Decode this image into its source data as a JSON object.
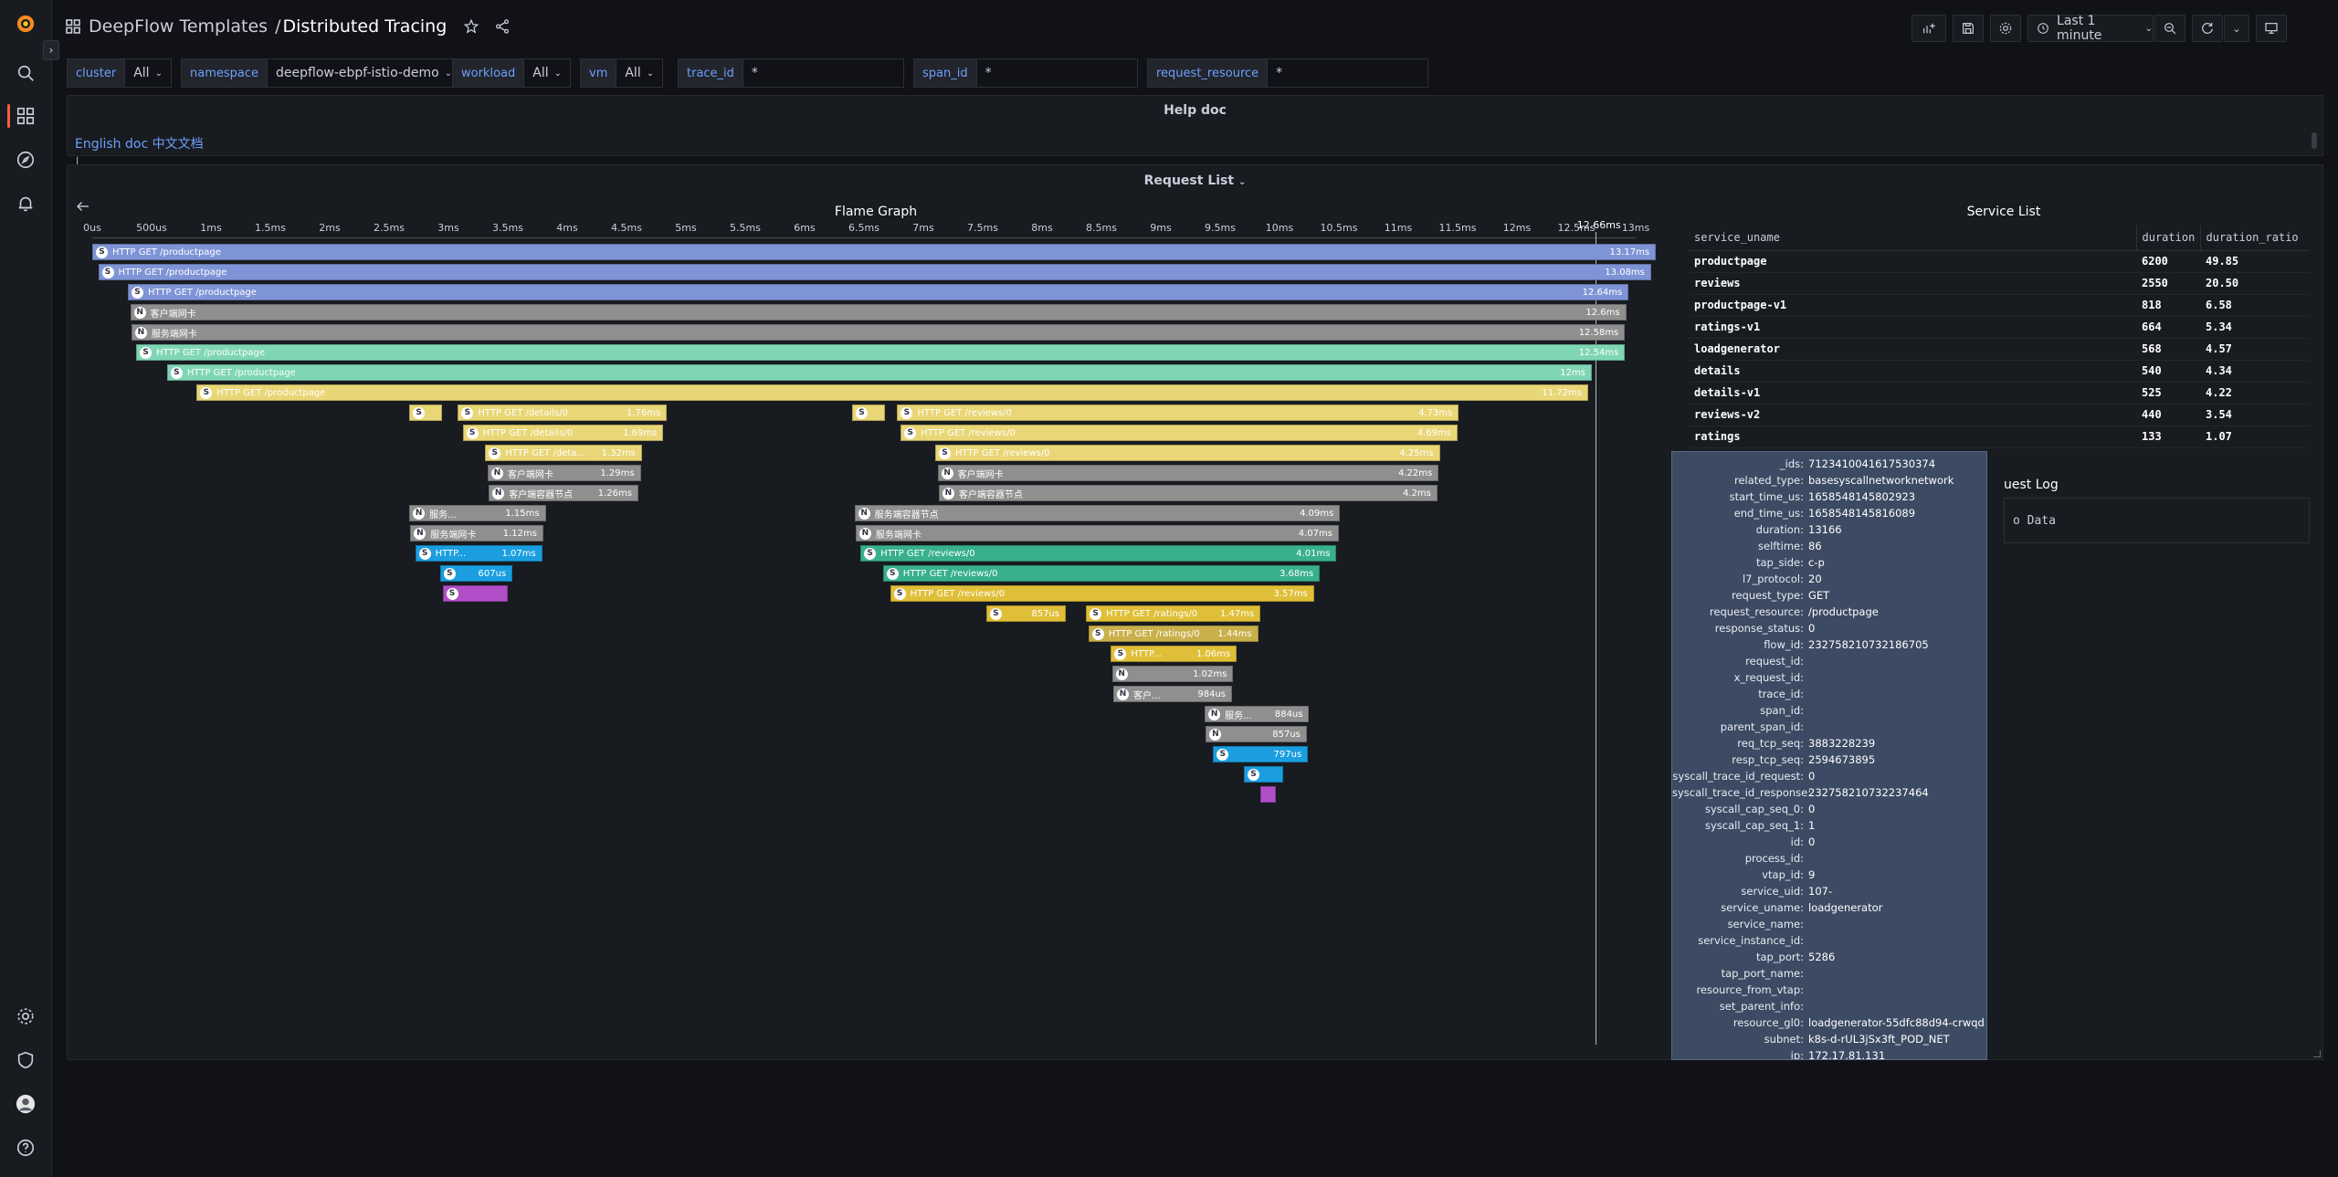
{
  "breadcrumb": {
    "folder": "DeepFlow Templates",
    "separator": "/",
    "page": "Distributed Tracing"
  },
  "toolbar": {
    "time_range": "Last 1 minute"
  },
  "variables": [
    {
      "label": "cluster",
      "value": "All",
      "dropdown": true
    },
    {
      "label": "namespace",
      "value": "deepflow-ebpf-istio-demo",
      "dropdown": true
    },
    {
      "label": "workload",
      "value": "All",
      "dropdown": true
    },
    {
      "label": "vm",
      "value": "All",
      "dropdown": true
    },
    {
      "label": "trace_id",
      "value": "*",
      "dropdown": false
    },
    {
      "label": "span_id",
      "value": "*",
      "dropdown": false
    },
    {
      "label": "request_resource",
      "value": "*",
      "dropdown": false
    }
  ],
  "help": {
    "title": "Help doc",
    "link_en": "English doc",
    "separator": "|",
    "link_zh": "中文文档"
  },
  "request_list": {
    "title": "Request List"
  },
  "flame_graph": {
    "title": "Flame Graph",
    "ticks": [
      "0us",
      "500us",
      "1ms",
      "1.5ms",
      "2ms",
      "2.5ms",
      "3ms",
      "3.5ms",
      "4ms",
      "4.5ms",
      "5ms",
      "5.5ms",
      "6ms",
      "6.5ms",
      "7ms",
      "7.5ms",
      "8ms",
      "8.5ms",
      "9ms",
      "9.5ms",
      "10ms",
      "10.5ms",
      "11ms",
      "11.5ms",
      "12ms",
      "12.5ms",
      "13ms"
    ],
    "cursor_label": "12.66ms",
    "cursor_value_ms": 12.66,
    "colors": {
      "blue": "#7f94d6",
      "green": "#7fd6b5",
      "yellow": "#e9d676",
      "gray": "#8f8f8f",
      "teal": "#38b08c",
      "cyan": "#1a9ee0",
      "purple": "#b14ec8",
      "gold": "#e0bf38",
      "mustard": "#c9b04a"
    },
    "bars": [
      {
        "icon": "S",
        "label": "HTTP GET /productpage",
        "dur": "13.17ms",
        "start": 0.0,
        "end": 13.17,
        "color": "blue"
      },
      {
        "icon": "S",
        "label": "HTTP GET /productpage",
        "dur": "13.08ms",
        "start": 0.05,
        "end": 13.13,
        "color": "blue"
      },
      {
        "icon": "S",
        "label": "HTTP GET /productpage",
        "dur": "12.64ms",
        "start": 0.3,
        "end": 12.94,
        "color": "blue"
      },
      {
        "icon": "N",
        "label": "客户端网卡",
        "dur": "12.6ms",
        "start": 0.32,
        "end": 12.92,
        "color": "gray"
      },
      {
        "icon": "N",
        "label": "服务端网卡",
        "dur": "12.58ms",
        "start": 0.33,
        "end": 12.91,
        "color": "gray"
      },
      {
        "icon": "S",
        "label": "HTTP GET /productpage",
        "dur": "12.54ms",
        "start": 0.37,
        "end": 12.91,
        "color": "green"
      },
      {
        "icon": "S",
        "label": "HTTP GET /productpage",
        "dur": "12ms",
        "start": 0.63,
        "end": 12.63,
        "color": "green"
      },
      {
        "icon": "S",
        "label": "HTTP GET /productpage",
        "dur": "11.72ms",
        "start": 0.88,
        "end": 12.6,
        "color": "yellow"
      },
      {
        "icon": "S",
        "label": "",
        "dur": "",
        "start": 2.67,
        "end": 2.95,
        "color": "yellow"
      },
      {
        "icon": "S",
        "label": "HTTP GET /details/0",
        "dur": "1.76ms",
        "start": 3.08,
        "end": 4.84,
        "color": "yellow"
      },
      {
        "icon": "S",
        "label": "",
        "dur": "",
        "start": 6.4,
        "end": 6.68,
        "color": "yellow"
      },
      {
        "icon": "S",
        "label": "HTTP GET /reviews/0",
        "dur": "4.73ms",
        "start": 6.78,
        "end": 11.51,
        "color": "yellow"
      },
      {
        "icon": "S",
        "label": "HTTP GET /details/0",
        "dur": "1.69ms",
        "start": 3.12,
        "end": 4.81,
        "color": "yellow"
      },
      {
        "icon": "S",
        "label": "HTTP GET /reviews/0",
        "dur": "4.69ms",
        "start": 6.81,
        "end": 11.5,
        "color": "yellow"
      },
      {
        "icon": "S",
        "label": "HTTP GET /deta...",
        "dur": "1.32ms",
        "start": 3.31,
        "end": 4.63,
        "color": "yellow"
      },
      {
        "icon": "S",
        "label": "HTTP GET /reviews/0",
        "dur": "4.25ms",
        "start": 7.1,
        "end": 11.35,
        "color": "yellow"
      },
      {
        "icon": "N",
        "label": "客户端网卡",
        "dur": "1.29ms",
        "start": 3.33,
        "end": 4.62,
        "color": "gray"
      },
      {
        "icon": "N",
        "label": "客户端网卡",
        "dur": "4.22ms",
        "start": 7.12,
        "end": 11.34,
        "color": "gray"
      },
      {
        "icon": "N",
        "label": "客户端容器节点",
        "dur": "1.26ms",
        "start": 3.34,
        "end": 4.6,
        "color": "gray"
      },
      {
        "icon": "N",
        "label": "客户端容器节点",
        "dur": "4.2ms",
        "start": 7.13,
        "end": 11.33,
        "color": "gray"
      },
      {
        "icon": "N",
        "label": "服务...",
        "dur": "1.15ms",
        "start": 2.67,
        "end": 3.82,
        "color": "gray"
      },
      {
        "icon": "N",
        "label": "服务端容器节点",
        "dur": "4.09ms",
        "start": 6.42,
        "end": 10.51,
        "color": "gray"
      },
      {
        "icon": "N",
        "label": "服务端网卡",
        "dur": "1.12ms",
        "start": 2.68,
        "end": 3.8,
        "color": "gray"
      },
      {
        "icon": "N",
        "label": "服务端网卡",
        "dur": "4.07ms",
        "start": 6.43,
        "end": 10.5,
        "color": "gray"
      },
      {
        "icon": "S",
        "label": "HTTP...",
        "dur": "1.07ms",
        "start": 2.72,
        "end": 3.79,
        "color": "cyan"
      },
      {
        "icon": "S",
        "label": "HTTP GET /reviews/0",
        "dur": "4.01ms",
        "start": 6.47,
        "end": 10.48,
        "color": "teal"
      },
      {
        "icon": "S",
        "label": "",
        "dur": "607us",
        "start": 2.93,
        "end": 3.54,
        "color": "cyan"
      },
      {
        "icon": "S",
        "label": "HTTP GET /reviews/0",
        "dur": "3.68ms",
        "start": 6.66,
        "end": 10.34,
        "color": "teal"
      },
      {
        "icon": "S",
        "label": "",
        "dur": "",
        "start": 2.95,
        "end": 3.5,
        "color": "purple"
      },
      {
        "icon": "S",
        "label": "HTTP GET /reviews/0",
        "dur": "3.57ms",
        "start": 6.72,
        "end": 10.29,
        "color": "gold"
      },
      {
        "icon": "S",
        "label": "",
        "dur": "857us",
        "start": 7.53,
        "end": 8.2,
        "color": "gold"
      },
      {
        "icon": "S",
        "label": "HTTP GET /ratings/0",
        "dur": "1.47ms",
        "start": 8.37,
        "end": 9.84,
        "color": "gold"
      },
      {
        "icon": "S",
        "label": "HTTP GET /ratings/0",
        "dur": "1.44ms",
        "start": 8.39,
        "end": 9.82,
        "color": "mustard"
      },
      {
        "icon": "S",
        "label": "HTTP...",
        "dur": "1.06ms",
        "start": 8.58,
        "end": 9.64,
        "color": "gold"
      },
      {
        "icon": "N",
        "label": "",
        "dur": "1.02ms",
        "start": 8.59,
        "end": 9.61,
        "color": "gray"
      },
      {
        "icon": "N",
        "label": "客户...",
        "dur": "984us",
        "start": 8.6,
        "end": 9.6,
        "color": "gray"
      },
      {
        "icon": "N",
        "label": "服务...",
        "dur": "884us",
        "start": 9.37,
        "end": 10.25,
        "color": "gray"
      },
      {
        "icon": "N",
        "label": "",
        "dur": "857us",
        "start": 9.38,
        "end": 10.23,
        "color": "gray"
      },
      {
        "icon": "S",
        "label": "",
        "dur": "797us",
        "start": 9.44,
        "end": 10.24,
        "color": "cyan"
      },
      {
        "icon": "S",
        "label": "",
        "dur": "",
        "start": 9.7,
        "end": 10.03,
        "color": "cyan"
      },
      {
        "icon": "",
        "label": "",
        "dur": "",
        "start": 9.84,
        "end": 9.97,
        "color": "purple"
      }
    ],
    "rows": [
      0,
      1,
      2,
      3,
      4,
      5,
      6,
      7,
      8,
      8,
      8,
      8,
      9,
      9,
      10,
      10,
      11,
      11,
      12,
      12,
      13,
      13,
      14,
      14,
      15,
      15,
      16,
      16,
      17,
      17,
      18,
      18,
      19,
      20,
      21,
      22,
      23,
      24,
      25,
      26,
      27
    ]
  },
  "service_list": {
    "title": "Service List",
    "columns": [
      "service_uname",
      "duration",
      "duration_ratio"
    ],
    "rows": [
      [
        "productpage",
        "6200",
        "49.85"
      ],
      [
        "reviews",
        "2550",
        "20.50"
      ],
      [
        "productpage-v1",
        "818",
        "6.58"
      ],
      [
        "ratings-v1",
        "664",
        "5.34"
      ],
      [
        "loadgenerator",
        "568",
        "4.57"
      ],
      [
        "details",
        "540",
        "4.34"
      ],
      [
        "details-v1",
        "525",
        "4.22"
      ],
      [
        "reviews-v2",
        "440",
        "3.54"
      ],
      [
        "ratings",
        "133",
        "1.07"
      ]
    ]
  },
  "request_log": {
    "title_visible": "uest Log",
    "nodata_visible": "o Data"
  },
  "tooltip": [
    [
      "_ids:",
      "7123410041617530374"
    ],
    [
      "related_type:",
      "basesyscallnetworknetwork"
    ],
    [
      "start_time_us:",
      "1658548145802923"
    ],
    [
      "end_time_us:",
      "1658548145816089"
    ],
    [
      "duration:",
      "13166"
    ],
    [
      "selftime:",
      "86"
    ],
    [
      "tap_side:",
      "c-p"
    ],
    [
      "l7_protocol:",
      "20"
    ],
    [
      "request_type:",
      "GET"
    ],
    [
      "request_resource:",
      "/productpage"
    ],
    [
      "response_status:",
      "0"
    ],
    [
      "flow_id:",
      "232758210732186705"
    ],
    [
      "request_id:",
      ""
    ],
    [
      "x_request_id:",
      ""
    ],
    [
      "trace_id:",
      ""
    ],
    [
      "span_id:",
      ""
    ],
    [
      "parent_span_id:",
      ""
    ],
    [
      "req_tcp_seq:",
      "3883228239"
    ],
    [
      "resp_tcp_seq:",
      "2594673895"
    ],
    [
      "syscall_trace_id_request:",
      "0"
    ],
    [
      "syscall_trace_id_response:",
      "232758210732237464"
    ],
    [
      "syscall_cap_seq_0:",
      "0"
    ],
    [
      "syscall_cap_seq_1:",
      "1"
    ],
    [
      "id:",
      "0"
    ],
    [
      "process_id:",
      ""
    ],
    [
      "vtap_id:",
      "9"
    ],
    [
      "service_uid:",
      "107-"
    ],
    [
      "service_uname:",
      "loadgenerator"
    ],
    [
      "service_name:",
      ""
    ],
    [
      "service_instance_id:",
      ""
    ],
    [
      "tap_port:",
      "5286"
    ],
    [
      "tap_port_name:",
      ""
    ],
    [
      "resource_from_vtap:",
      ""
    ],
    [
      "set_parent_info:",
      ""
    ],
    [
      "resource_gl0:",
      "loadgenerator-55dfc88d94-crwqd"
    ],
    [
      "subnet:",
      "k8s-d-rUL3jSx3ft_POD_NET"
    ],
    [
      "ip:",
      "172.17.81.131"
    ]
  ],
  "icons": [
    "grafana-logo-icon",
    "search-icon",
    "dashboards-icon",
    "explore-icon",
    "alerting-icon",
    "settings-icon",
    "shield-icon",
    "user-avatar-icon",
    "help-icon",
    "star-icon",
    "share-icon",
    "add-panel-icon",
    "save-icon",
    "dashboard-settings-icon",
    "clock-icon",
    "zoom-out-icon",
    "refresh-icon",
    "tv-mode-icon",
    "back-arrow-icon"
  ]
}
